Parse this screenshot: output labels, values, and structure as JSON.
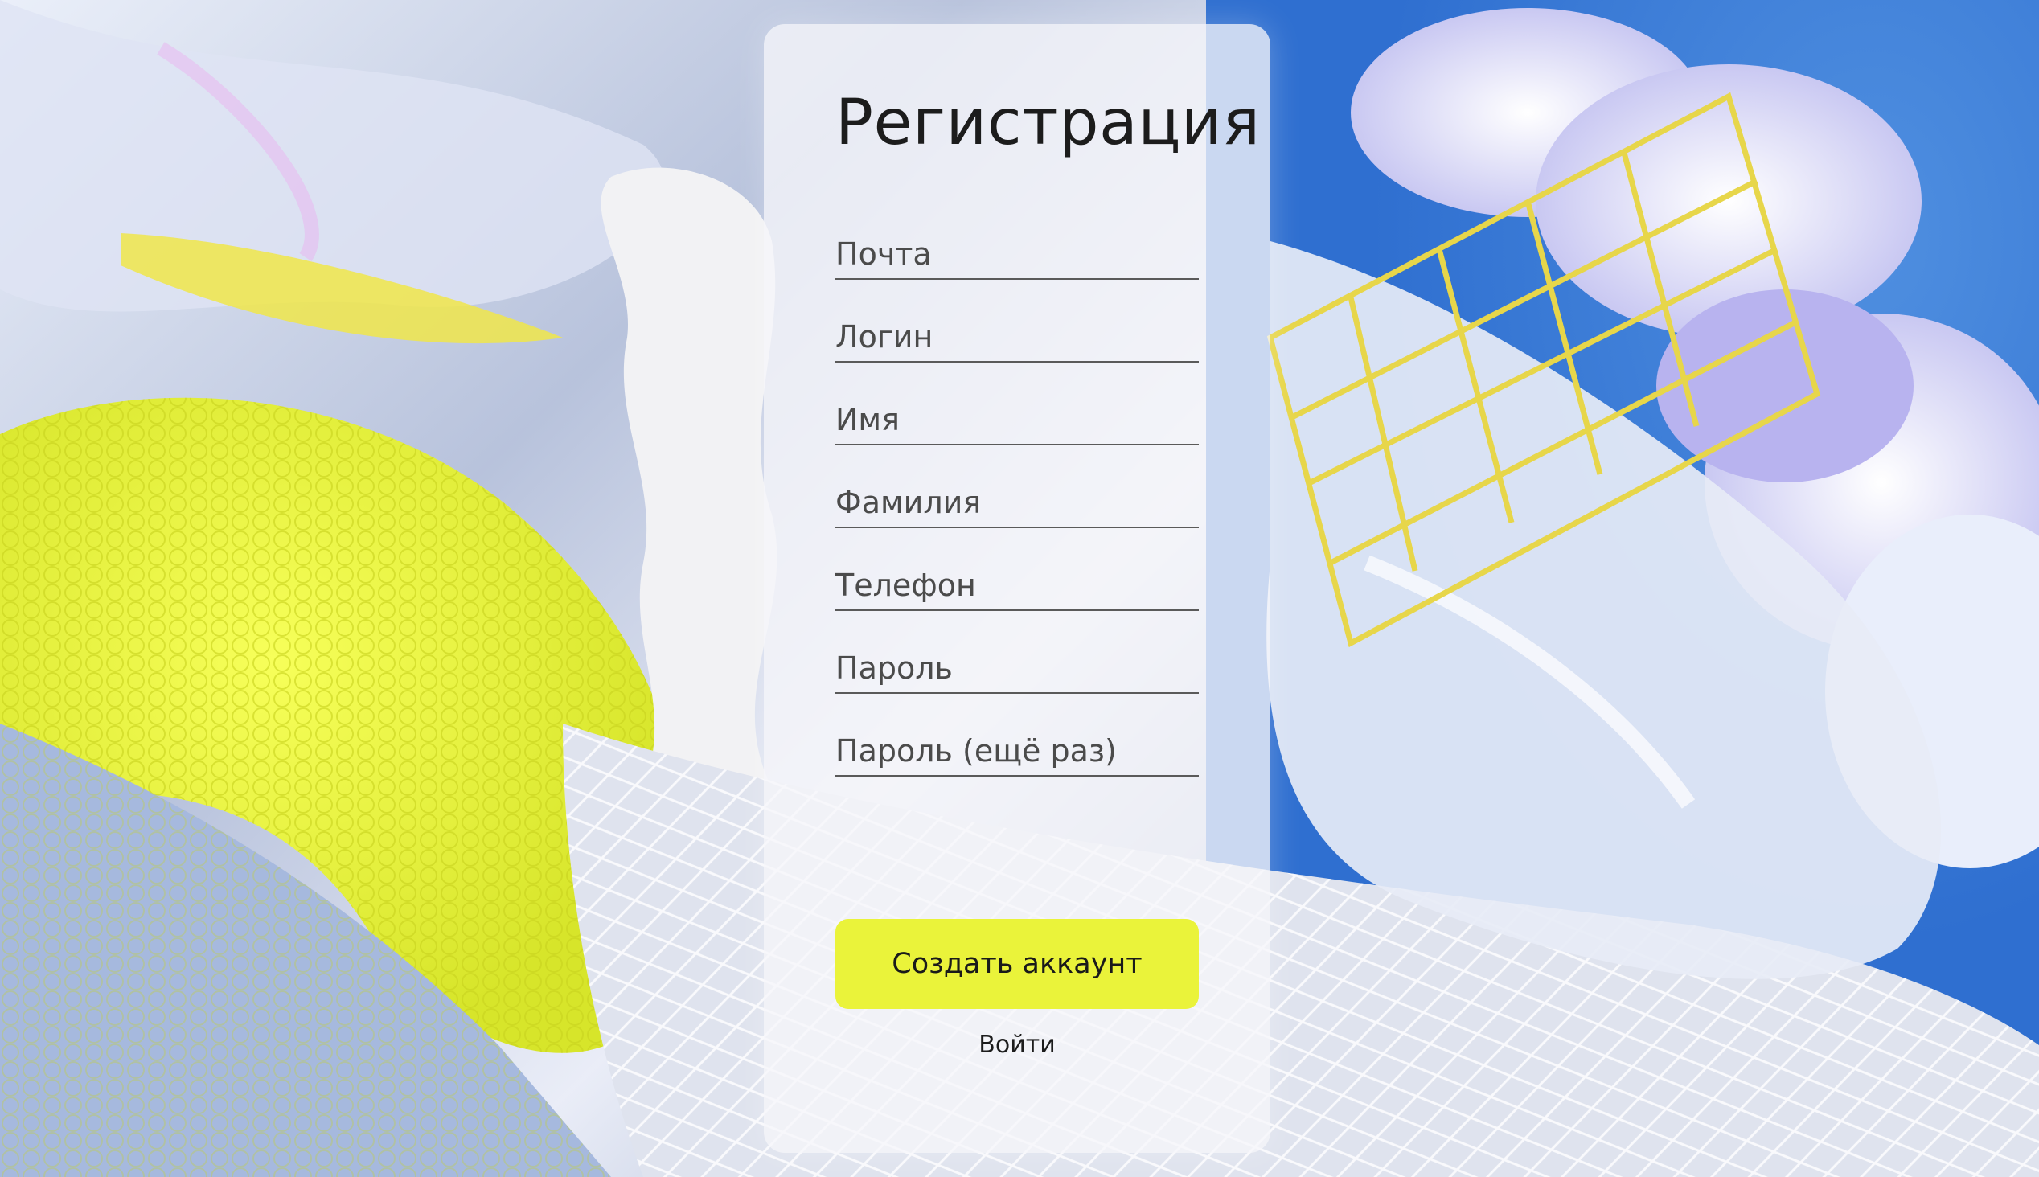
{
  "form": {
    "title": "Регистрация",
    "fields": [
      {
        "name": "email",
        "placeholder": "Почта"
      },
      {
        "name": "login",
        "placeholder": "Логин"
      },
      {
        "name": "first-name",
        "placeholder": "Имя"
      },
      {
        "name": "last-name",
        "placeholder": "Фамилия"
      },
      {
        "name": "phone",
        "placeholder": "Телефон"
      },
      {
        "name": "password",
        "placeholder": "Пароль"
      },
      {
        "name": "password-repeat",
        "placeholder": "Пароль (ещё раз)"
      }
    ],
    "submit_label": "Создать аккаунт",
    "login_link": "Войти"
  },
  "colors": {
    "accent": "#eaf33a",
    "card": "#f6f6fa",
    "text": "#1c1c1c"
  }
}
